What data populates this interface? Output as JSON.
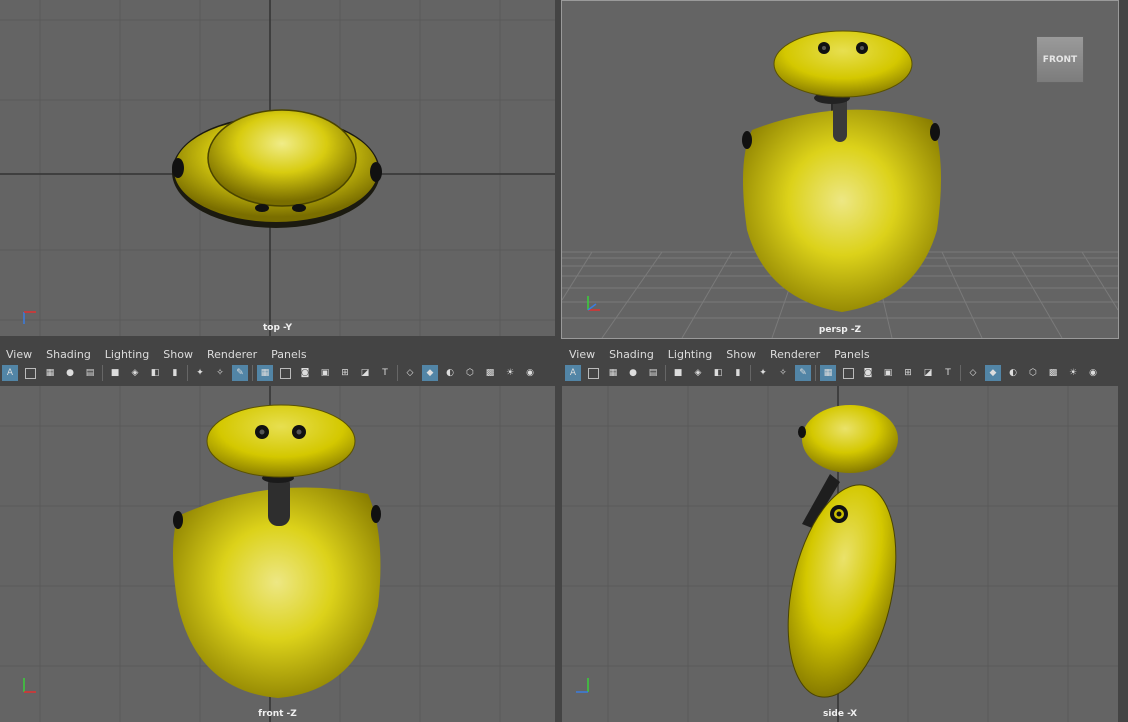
{
  "viewports": {
    "top": {
      "label": "top -Y"
    },
    "persp": {
      "label": "persp -Z"
    },
    "front": {
      "label": "front -Z"
    },
    "side": {
      "label": "side -X"
    }
  },
  "panel_menu": [
    "View",
    "Shading",
    "Lighting",
    "Show",
    "Renderer",
    "Panels"
  ],
  "view_cube": {
    "label": "FRONT"
  },
  "axis_labels": {
    "x": "x",
    "y": "y",
    "z": "z"
  },
  "toolbar_icons": [
    "select-camera-icon",
    "camera-attributes-icon",
    "bookmark-icon",
    "image-plane-icon",
    "grease-pencil-icon",
    "camera-icon",
    "2d-pan-icon",
    "frame-all-icon",
    "frame-selected-icon",
    "grid-icon",
    "film-gate-icon",
    "resolution-gate-icon",
    "gate-mask-icon",
    "field-chart-icon",
    "safe-action-icon",
    "safe-title-icon",
    "wireframe-icon",
    "smooth-shade-icon",
    "wireframe-on-shaded-icon",
    "textured-icon",
    "default-lighting-icon",
    "shadows-icon",
    "isolate-select-icon",
    "xray-icon"
  ],
  "colors": {
    "viewport_bg": "#646464",
    "model": "#d4c800",
    "panel_bg": "#444444",
    "highlight": "#5285a6"
  }
}
